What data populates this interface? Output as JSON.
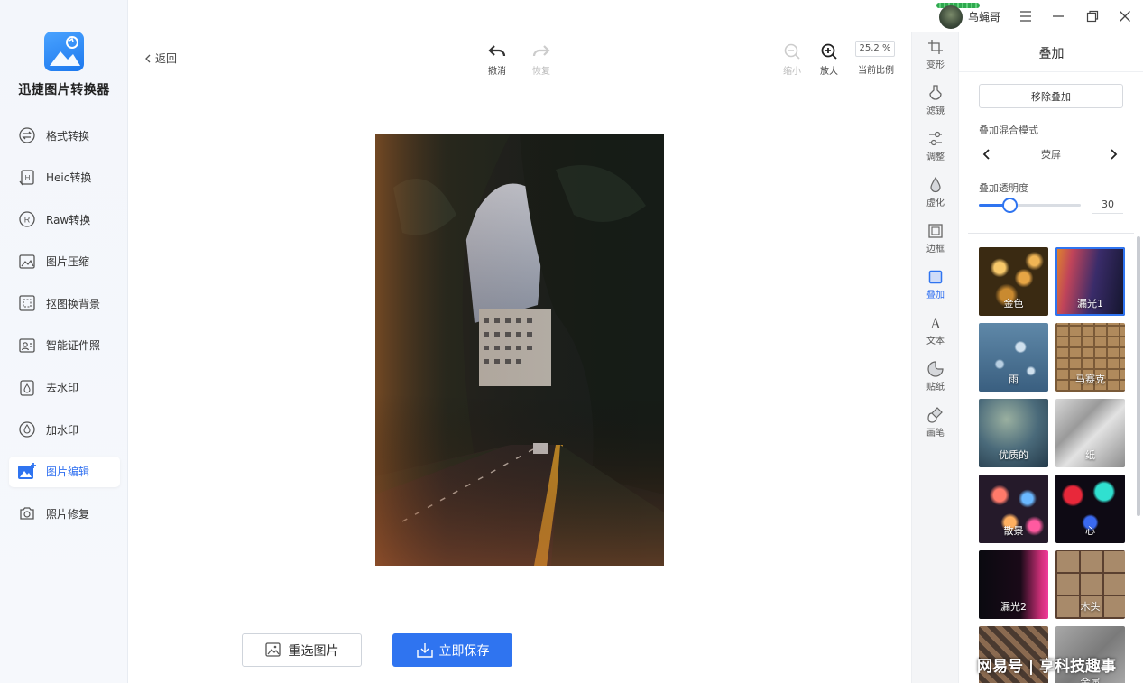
{
  "app": {
    "name": "迅捷图片转换器"
  },
  "sidebar": {
    "items": [
      {
        "label": "格式转换",
        "icon": "format-convert-icon"
      },
      {
        "label": "Heic转换",
        "icon": "heic-icon"
      },
      {
        "label": "Raw转换",
        "icon": "raw-icon"
      },
      {
        "label": "图片压缩",
        "icon": "compress-icon"
      },
      {
        "label": "抠图换背景",
        "icon": "cutout-icon"
      },
      {
        "label": "智能证件照",
        "icon": "id-photo-icon"
      },
      {
        "label": "去水印",
        "icon": "remove-watermark-icon"
      },
      {
        "label": "加水印",
        "icon": "add-watermark-icon"
      },
      {
        "label": "图片编辑",
        "icon": "image-edit-icon",
        "active": true
      },
      {
        "label": "照片修复",
        "icon": "photo-repair-icon"
      }
    ]
  },
  "titlebar": {
    "username": "乌蝇哥"
  },
  "toolbar": {
    "back": "返回",
    "undo": "撤消",
    "redo": "恢复",
    "zoom_out": "缩小",
    "zoom_in": "放大",
    "zoom_value": "25.2 %",
    "current_ratio": "当前比例"
  },
  "actions": {
    "reselect": "重选图片",
    "save": "立即保存"
  },
  "tools": [
    {
      "label": "变形",
      "icon": "crop-icon"
    },
    {
      "label": "滤镜",
      "icon": "filter-icon"
    },
    {
      "label": "调整",
      "icon": "adjust-icon"
    },
    {
      "label": "虚化",
      "icon": "blur-icon"
    },
    {
      "label": "边框",
      "icon": "frame-icon"
    },
    {
      "label": "叠加",
      "icon": "overlay-icon",
      "active": true
    },
    {
      "label": "文本",
      "icon": "text-icon"
    },
    {
      "label": "贴纸",
      "icon": "sticker-icon"
    },
    {
      "label": "画笔",
      "icon": "brush-icon"
    }
  ],
  "panel": {
    "title": "叠加",
    "remove_button": "移除叠加",
    "blend_mode_label": "叠加混合模式",
    "blend_mode_value": "荧屏",
    "opacity_label": "叠加透明度",
    "opacity_value": "30",
    "opacity_fraction": 0.3
  },
  "overlays": [
    {
      "label": "金色"
    },
    {
      "label": "漏光1",
      "selected": true
    },
    {
      "label": "雨"
    },
    {
      "label": "马赛克"
    },
    {
      "label": "优质的"
    },
    {
      "label": "纸"
    },
    {
      "label": "散景"
    },
    {
      "label": "心"
    },
    {
      "label": "漏光2"
    },
    {
      "label": "木头"
    },
    {
      "label": ""
    },
    {
      "label": "金属"
    }
  ],
  "watermark": "网易号 | 享科技趣事",
  "colors": {
    "accent": "#2f74f0",
    "sidebar_bg": "#f3f6fb"
  }
}
